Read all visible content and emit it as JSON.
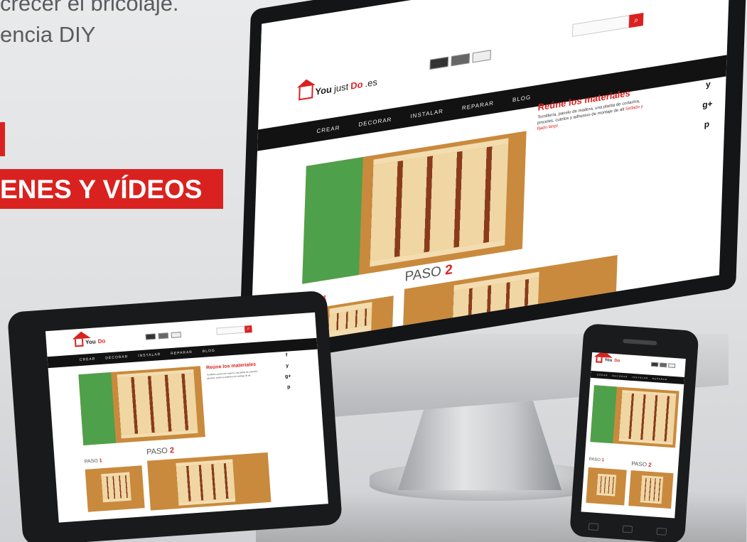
{
  "promo": {
    "line1": "crecer el bricolaje.",
    "line2": "encia DIY",
    "badge": "ENES Y VÍDEOS"
  },
  "site": {
    "logo_you": "You",
    "logo_just": "just",
    "logo_do": "Do",
    "logo_tld": ".es",
    "menu": [
      "CREAR",
      "DECORAR",
      "INSTALAR",
      "REPARAR",
      "BLOG"
    ],
    "materials_title": "Reúne los materiales",
    "materials_text": "Tornillería, panelo de madera, una planta de cortar/ira, pinceles, cutelos y adhesivo de montaje de alt",
    "materials_link": "Sellado y fijado largo",
    "paso1_label": "PASO",
    "paso1_num": "1",
    "paso2_label": "PASO",
    "paso2_num": "2",
    "search_icon": "search-icon",
    "social": [
      "f",
      "y",
      "g+",
      "p"
    ]
  },
  "colors": {
    "accent": "#d9221f",
    "menu_bg": "#121212",
    "wood": "#c98a3d"
  }
}
